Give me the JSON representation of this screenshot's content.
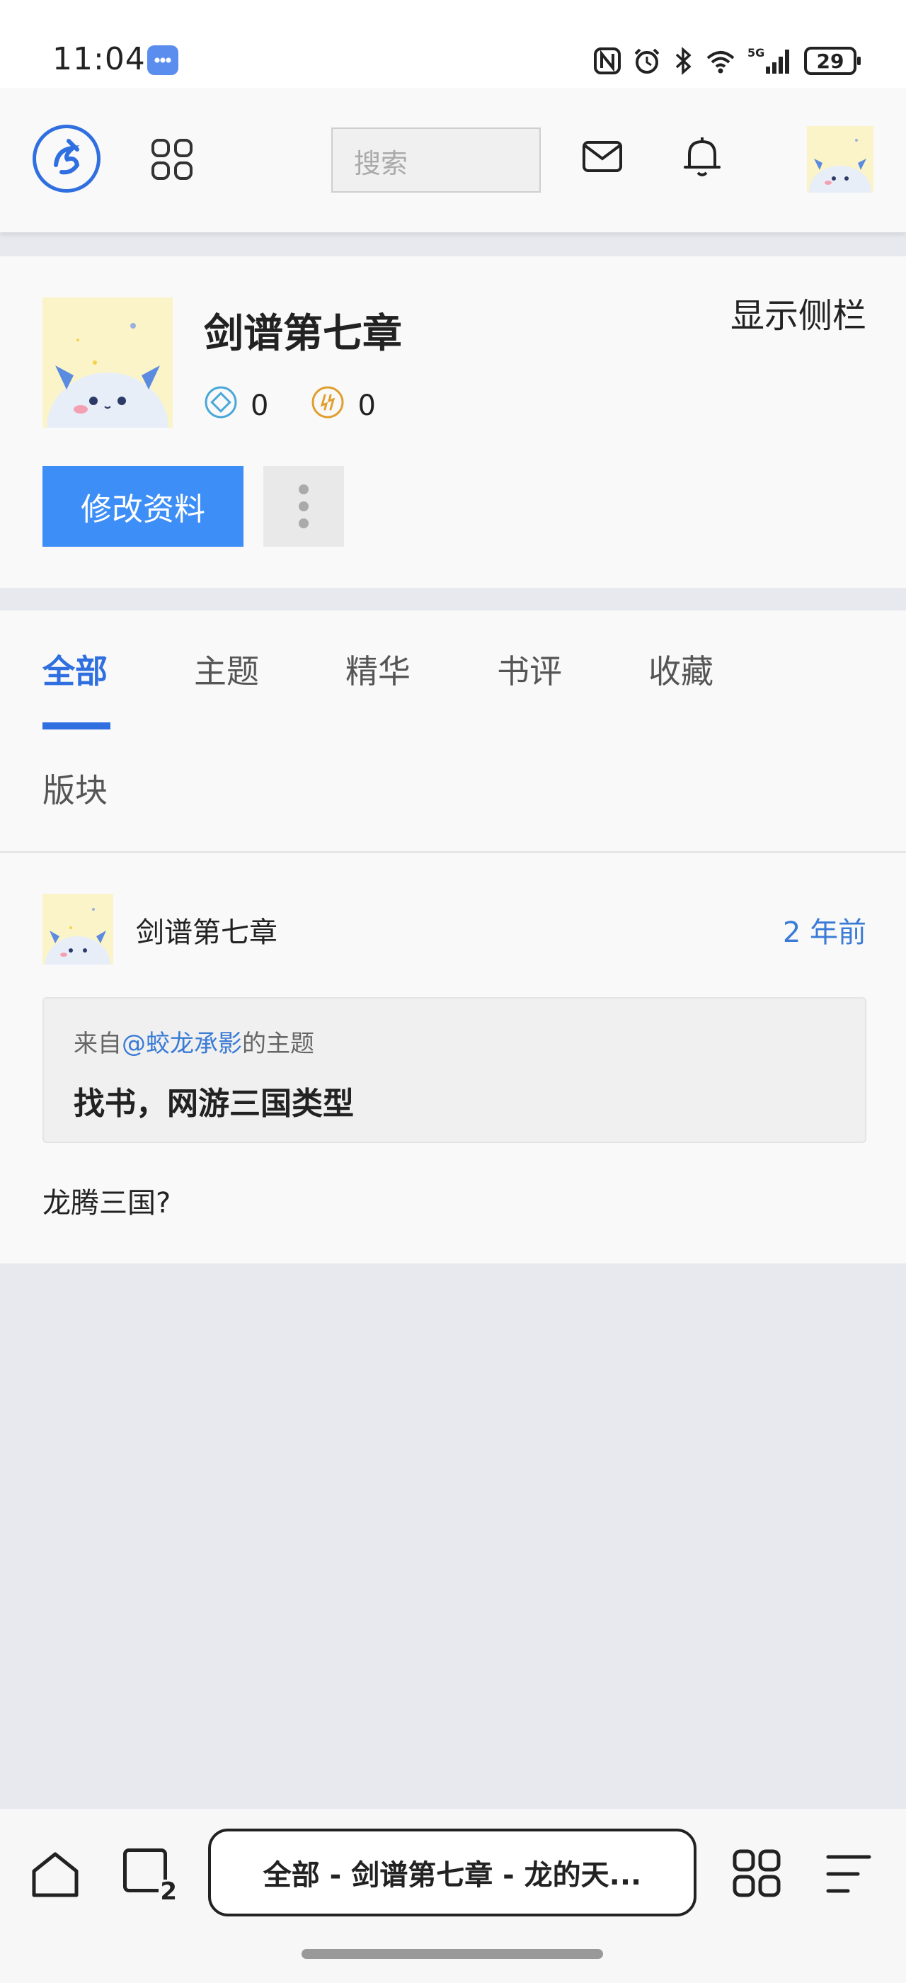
{
  "status_bar": {
    "time": "11:04",
    "battery": "29",
    "network": "5G"
  },
  "topnav": {
    "search_placeholder": "搜索"
  },
  "profile": {
    "name": "剑谱第七章",
    "sidebar_toggle": "显示侧栏",
    "stat_diamond": "0",
    "stat_coin": "0",
    "edit_label": "修改资料"
  },
  "tabs": {
    "all": "全部",
    "threads": "主题",
    "featured": "精华",
    "reviews": "书评",
    "favorites": "收藏",
    "forums": "版块"
  },
  "post": {
    "author": "剑谱第七章",
    "time": "2 年前",
    "quote_prefix": "来自",
    "quote_user": "@蛟龙承影",
    "quote_suffix": "的主题",
    "quote_title": "找书，网游三国类型",
    "body": "龙腾三国?"
  },
  "browser": {
    "tab_count": "2",
    "page_title": "全部 - 剑谱第七章 - 龙的天..."
  },
  "colors": {
    "accent": "#2f6fe0",
    "button": "#3d8ef6",
    "link": "#3a7bd5",
    "background": "#e7e9ee"
  }
}
